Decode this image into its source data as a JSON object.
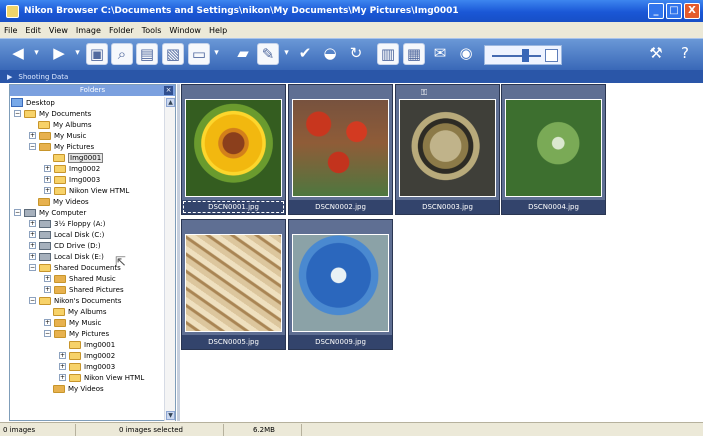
{
  "window": {
    "title": "Nikon Browser C:\\Documents and Settings\\nikon\\My Documents\\My Pictures\\Img0001",
    "controls": [
      "_",
      "□",
      "X"
    ]
  },
  "menu": [
    "File",
    "Edit",
    "View",
    "Image",
    "Folder",
    "Tools",
    "Window",
    "Help"
  ],
  "toolbar": {
    "buttons": [
      "back-icon",
      "forward-icon",
      "folder-up-icon",
      "search-image-icon",
      "pane-icon",
      "picture-icon",
      "slideshow-icon",
      "open-folder-icon",
      "edit-icon",
      "check-icon",
      "rating-icon",
      "rotate-icon",
      "print-icon",
      "screen-icon",
      "email-icon",
      "web-icon",
      "thumbnail-size-slider",
      "settings-icon",
      "help-icon"
    ],
    "help": "?"
  },
  "shooting_data": {
    "label": "Shooting Data"
  },
  "folders": {
    "title": "Folders",
    "close": "×",
    "scroll_up": "▲",
    "scroll_down": "▼",
    "items": [
      {
        "label": "Desktop",
        "kind": "desktop"
      },
      {
        "label": "My Documents",
        "kind": "folder"
      },
      {
        "label": "My Albums",
        "kind": "folder"
      },
      {
        "label": "My Music",
        "kind": "folder"
      },
      {
        "label": "My Pictures",
        "kind": "folder"
      },
      {
        "label": "Img0001",
        "kind": "folder",
        "selected": true
      },
      {
        "label": "Img0002",
        "kind": "folder"
      },
      {
        "label": "Img0003",
        "kind": "folder"
      },
      {
        "label": "Nikon View HTML",
        "kind": "folder"
      },
      {
        "label": "My Videos",
        "kind": "folder"
      },
      {
        "label": "My Computer",
        "kind": "computer"
      },
      {
        "label": "3½ Floppy (A:)",
        "kind": "drive"
      },
      {
        "label": "Local Disk (C:)",
        "kind": "drive"
      },
      {
        "label": "CD Drive (D:)",
        "kind": "drive"
      },
      {
        "label": "Local Disk (E:)",
        "kind": "drive"
      },
      {
        "label": "Shared Documents",
        "kind": "folder"
      },
      {
        "label": "Shared Music",
        "kind": "folder"
      },
      {
        "label": "Shared Pictures",
        "kind": "folder"
      },
      {
        "label": "Nikon's Documents",
        "kind": "folder"
      },
      {
        "label": "My Albums",
        "kind": "folder"
      },
      {
        "label": "My Music",
        "kind": "folder"
      },
      {
        "label": "My Pictures",
        "kind": "folder"
      },
      {
        "label": "Img0001",
        "kind": "folder"
      },
      {
        "label": "Img0002",
        "kind": "folder"
      },
      {
        "label": "Img0003",
        "kind": "folder"
      },
      {
        "label": "Nikon View HTML",
        "kind": "folder"
      },
      {
        "label": "My Videos",
        "kind": "folder"
      }
    ]
  },
  "thumbnails": [
    {
      "label": "DSCN0001.jpg",
      "subject": "sunflower"
    },
    {
      "label": "DSCN0002.jpg",
      "subject": "red flowers"
    },
    {
      "label": "DSCN0003.jpg",
      "subject": "pocket watch mechanism",
      "protected_icon": "key-icon"
    },
    {
      "label": "DSCN0004.jpg",
      "subject": "green leaves"
    },
    {
      "label": "DSCN0005.jpg",
      "subject": "wheat"
    },
    {
      "label": "DSCN0009.jpg",
      "subject": "blue bowl"
    }
  ],
  "status": {
    "images": "0 images",
    "selected": "0 images selected",
    "size": "6.2MB"
  }
}
